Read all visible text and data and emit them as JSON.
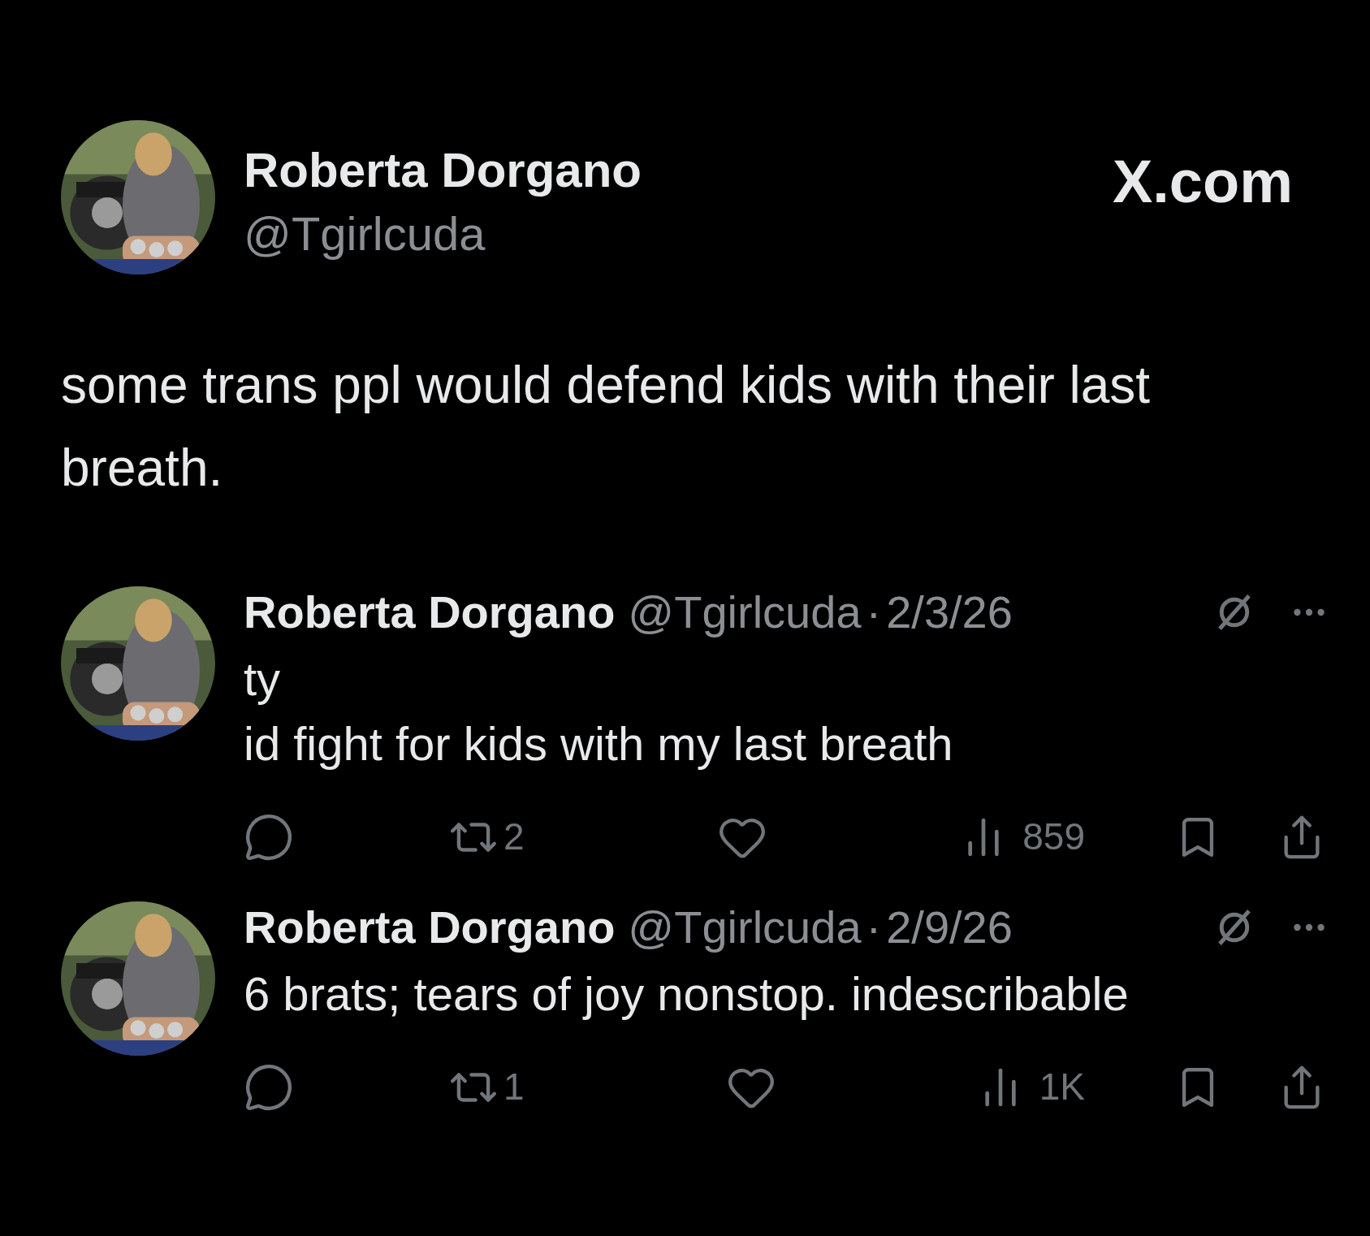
{
  "header": {
    "name": "Roberta Dorgano",
    "handle": "@Tgirlcuda",
    "site": "X.com"
  },
  "post": {
    "text": "some trans ppl would defend kids with their last breath."
  },
  "replies": [
    {
      "name": "Roberta Dorgano",
      "handle": "@Tgirlcuda",
      "separator": "·",
      "date": "2/3/26",
      "lines": [
        "ty",
        "id fight for kids with my last breath"
      ],
      "retweets": "2",
      "views": "859"
    },
    {
      "name": "Roberta Dorgano",
      "handle": "@Tgirlcuda",
      "separator": "·",
      "date": "2/9/26",
      "lines": [
        "6 brats; tears of joy nonstop. indescribable"
      ],
      "retweets": "1",
      "views": "1K"
    }
  ]
}
